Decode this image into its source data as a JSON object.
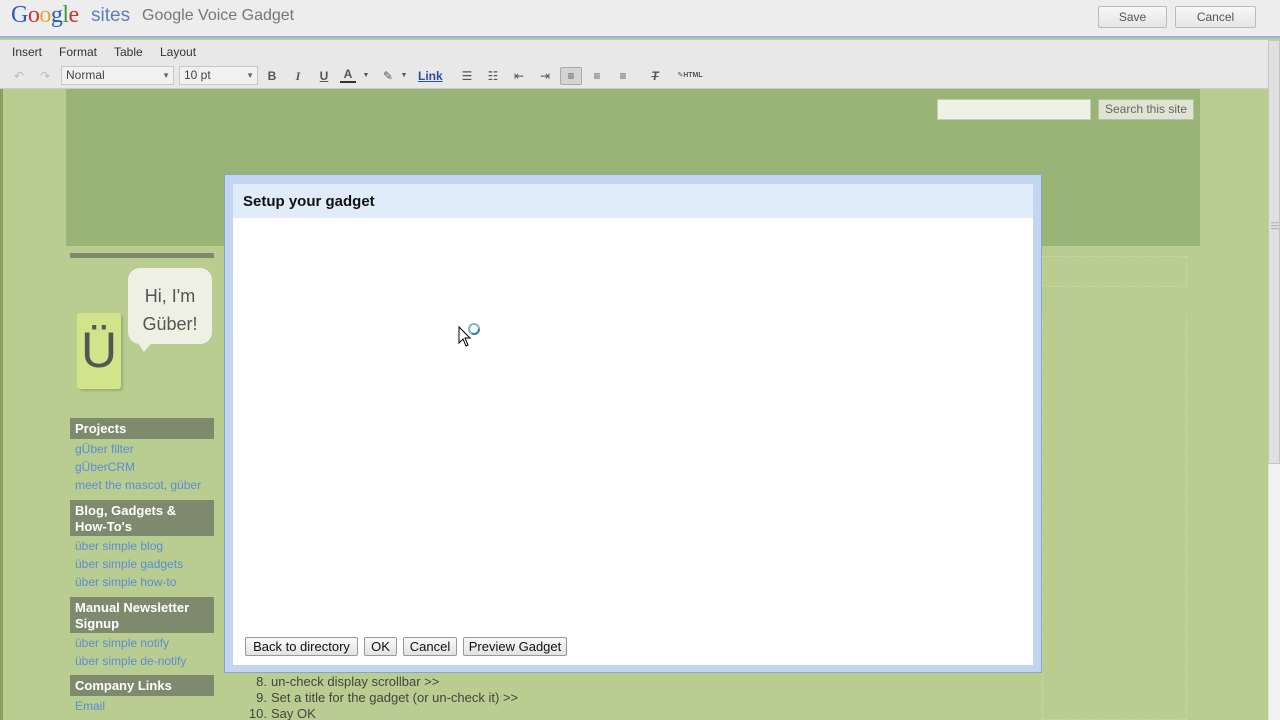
{
  "header": {
    "logo_google": "Google",
    "logo_sites": "sites",
    "page_name": "Google Voice Gadget",
    "save_label": "Save",
    "cancel_label": "Cancel"
  },
  "menu": [
    "Insert",
    "Format",
    "Table",
    "Layout"
  ],
  "toolbar": {
    "style_select": "Normal",
    "size_select": "10 pt",
    "bold": "B",
    "italic": "I",
    "underline": "U",
    "text_color": "A",
    "link_label": "Link",
    "html_label": "HTML",
    "icons": [
      "undo-icon",
      "redo-icon",
      "bold-icon",
      "italic-icon",
      "underline-icon",
      "text-color-icon",
      "highlight-icon",
      "numbered-list-icon",
      "bullet-list-icon",
      "outdent-icon",
      "indent-icon",
      "align-left-icon",
      "align-center-icon",
      "align-right-icon",
      "remove-format-icon",
      "html-icon"
    ]
  },
  "site": {
    "search_button": "Search this site",
    "search_value": ""
  },
  "sidebar": {
    "bubble_line1": "Hi, I'm",
    "bubble_line2": "Güber!",
    "mascot_letter": "Ü",
    "sections": [
      {
        "title": "Projects",
        "links": [
          "gÜber filter",
          "gÜberCRM",
          "meet the mascot, güber"
        ]
      },
      {
        "title": "Blog, Gadgets & How-To's",
        "links": [
          "über simple blog",
          "über simple gadgets",
          "über simple how-to"
        ]
      },
      {
        "title": "Manual Newsletter Signup",
        "links": [
          "über simple notify",
          "über simple de-notify"
        ]
      },
      {
        "title": "Company Links",
        "links": [
          "Email"
        ]
      }
    ]
  },
  "main_list": [
    {
      "num": "8.",
      "text": "un-check display scrollbar >>"
    },
    {
      "num": "9.",
      "text": "Set a title for the gadget (or un-check it) >>"
    },
    {
      "num": "10.",
      "text": "Say OK"
    }
  ],
  "dialog": {
    "title": "Setup your gadget",
    "buttons": {
      "back": "Back to directory",
      "ok": "OK",
      "cancel": "Cancel",
      "preview": "Preview Gadget"
    }
  },
  "colors": {
    "site_bg": "#b9cd90",
    "header_band": "#9ab477",
    "sidebar_head": "#7e8a6e",
    "link": "#5a8cd6",
    "dialog_border": "#c2d6f2",
    "dialog_title_bg": "#e1ecfb"
  }
}
